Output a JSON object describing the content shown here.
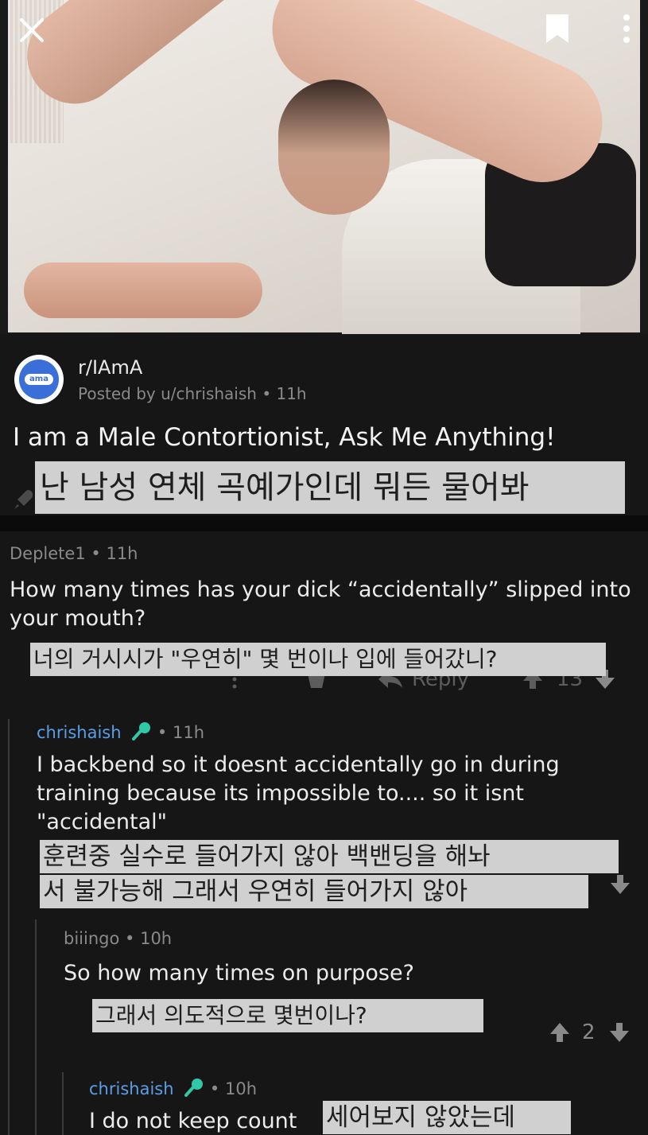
{
  "header": {
    "close_icon": "close-icon",
    "save_icon": "bookmark-icon",
    "more_icon": "more-vertical-icon"
  },
  "post": {
    "subreddit": "r/IAmA",
    "avatar_text": "ama",
    "posted_by": "Posted by u/chrishaish • 11h",
    "title": "I am a Male Contortionist, Ask Me Anything!",
    "title_translation": "난 남성 연체 곡예가인데 뭐든 물어봐"
  },
  "comments": [
    {
      "author": "Deplete1",
      "time": "• 11h",
      "body": "How many times has your dick “accidentally” slipped into your mouth?",
      "translation": "너의 거시시가 \"우연히\" 몇 번이나 입에 들어갔니?",
      "reply_label": "Reply",
      "score": "13"
    },
    {
      "author": "chrishaish",
      "time": "• 11h",
      "body": "I backbend so it doesnt accidentally go in during training because its impossible to.... so it isnt \"accidental\"",
      "translation_line1": "훈련중 실수로 들어가지 않아 백밴딩을 해놔",
      "translation_line2": "서 불가능해 그래서 우연히 들어가지 않아"
    },
    {
      "author": "biiingo",
      "time": "• 10h",
      "body": "So how many times on purpose?",
      "translation": "그래서 의도적으로 몇번이나?",
      "score": "2"
    },
    {
      "author": "chrishaish",
      "time": "• 10h",
      "body": "I do not keep count",
      "translation": "세어보지 않았는데"
    }
  ],
  "colors": {
    "background": "#161616",
    "op_username": "#5a9ee6",
    "mic_badge": "#2fc9a8",
    "overlay": "#d0d0d0"
  }
}
